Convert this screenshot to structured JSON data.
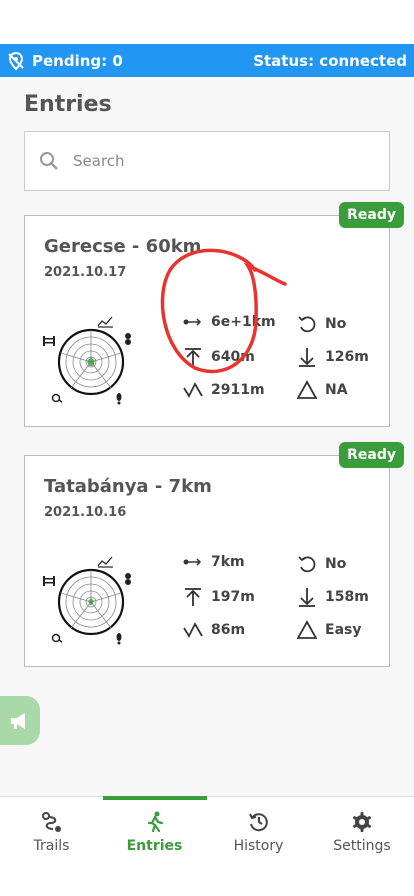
{
  "statusbar": {
    "pending": "Pending: 0",
    "status": "Status: connected"
  },
  "page_title": "Entries",
  "search": {
    "placeholder": "Search",
    "value": ""
  },
  "entries": [
    {
      "name": "Gerecse - 60km",
      "date": "2021.10.17",
      "badge": "Ready",
      "distance": "6e+1km",
      "loop": "No",
      "ascent": "640m",
      "descent": "126m",
      "max_elevation": "2911m",
      "difficulty": "NA"
    },
    {
      "name": "Tatabánya - 7km",
      "date": "2021.10.16",
      "badge": "Ready",
      "distance": "7km",
      "loop": "No",
      "ascent": "197m",
      "descent": "158m",
      "max_elevation": "86m",
      "difficulty": "Easy"
    }
  ],
  "nav": [
    {
      "label": "Trails",
      "icon": "route-icon"
    },
    {
      "label": "Entries",
      "icon": "hiking-icon",
      "active": true
    },
    {
      "label": "History",
      "icon": "history-icon"
    },
    {
      "label": "Settings",
      "icon": "gear-icon"
    }
  ],
  "colors": {
    "status_bar": "#2196f3",
    "accent_green": "#3a9c3a",
    "annotation_red": "#e8332f"
  }
}
